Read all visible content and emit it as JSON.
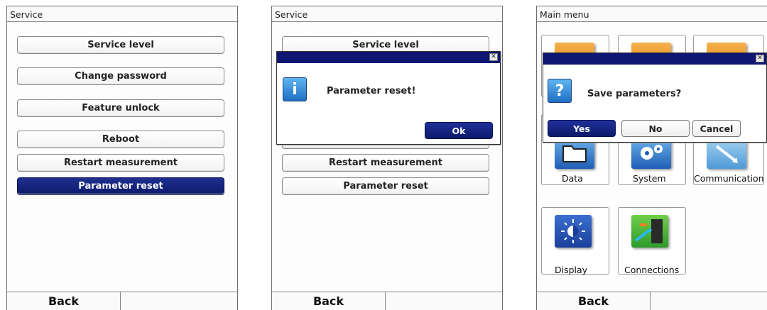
{
  "panel1": {
    "title": "Service",
    "menu": [
      "Service level",
      "Change password",
      "Feature unlock",
      "Reboot",
      "Restart measurement",
      "Parameter reset"
    ],
    "softkey_left": "Back",
    "softkey_right": ""
  },
  "panel2": {
    "title": "Service",
    "menu": [
      "Service level",
      "Restart measurement",
      "Parameter reset"
    ],
    "dialog": {
      "icon_glyph": "i",
      "message": "Parameter reset!",
      "close_glyph": "✕",
      "ok_label": "Ok"
    },
    "softkey_left": "Back",
    "softkey_right": ""
  },
  "panel3": {
    "title": "Main menu",
    "tiles": [
      "Data",
      "System",
      "Communication",
      "Display",
      "Connections"
    ],
    "dialog": {
      "icon_glyph": "?",
      "message": "Save parameters?",
      "close_glyph": "✕",
      "yes_label": "Yes",
      "no_label": "No",
      "cancel_label": "Cancel"
    },
    "softkey_left": "Back",
    "softkey_right": ""
  },
  "colors": {
    "selection_blue": "#0c1a6a",
    "dialog_header": "#0d1670",
    "icon_blue": "#1f6fc4"
  }
}
